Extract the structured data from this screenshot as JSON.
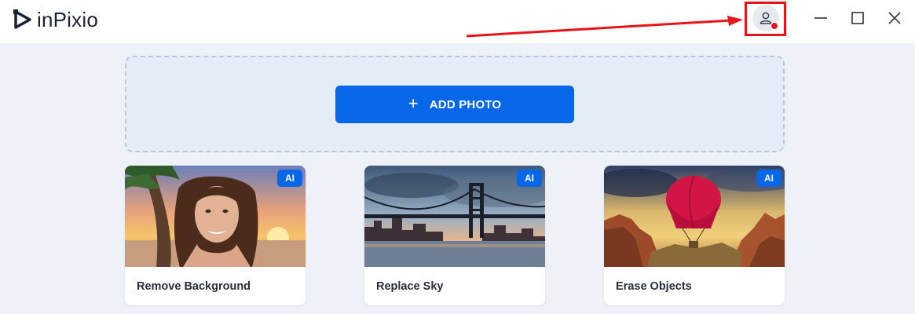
{
  "app": {
    "name": "inPixio"
  },
  "header": {
    "account_icon": "user-icon",
    "window_controls": [
      "minimize-icon",
      "maximize-icon",
      "close-icon"
    ]
  },
  "dropzone": {
    "button_label": "ADD PHOTO",
    "button_icon": "plus-icon"
  },
  "cards": [
    {
      "label": "Remove Background",
      "badge": "AI"
    },
    {
      "label": "Replace Sky",
      "badge": "AI"
    },
    {
      "label": "Erase Objects",
      "badge": "AI"
    }
  ],
  "colors": {
    "accent": "#0866e8",
    "annotation": "#e8141c",
    "notification_dot": "#e01b24",
    "background": "#eef2f8"
  }
}
